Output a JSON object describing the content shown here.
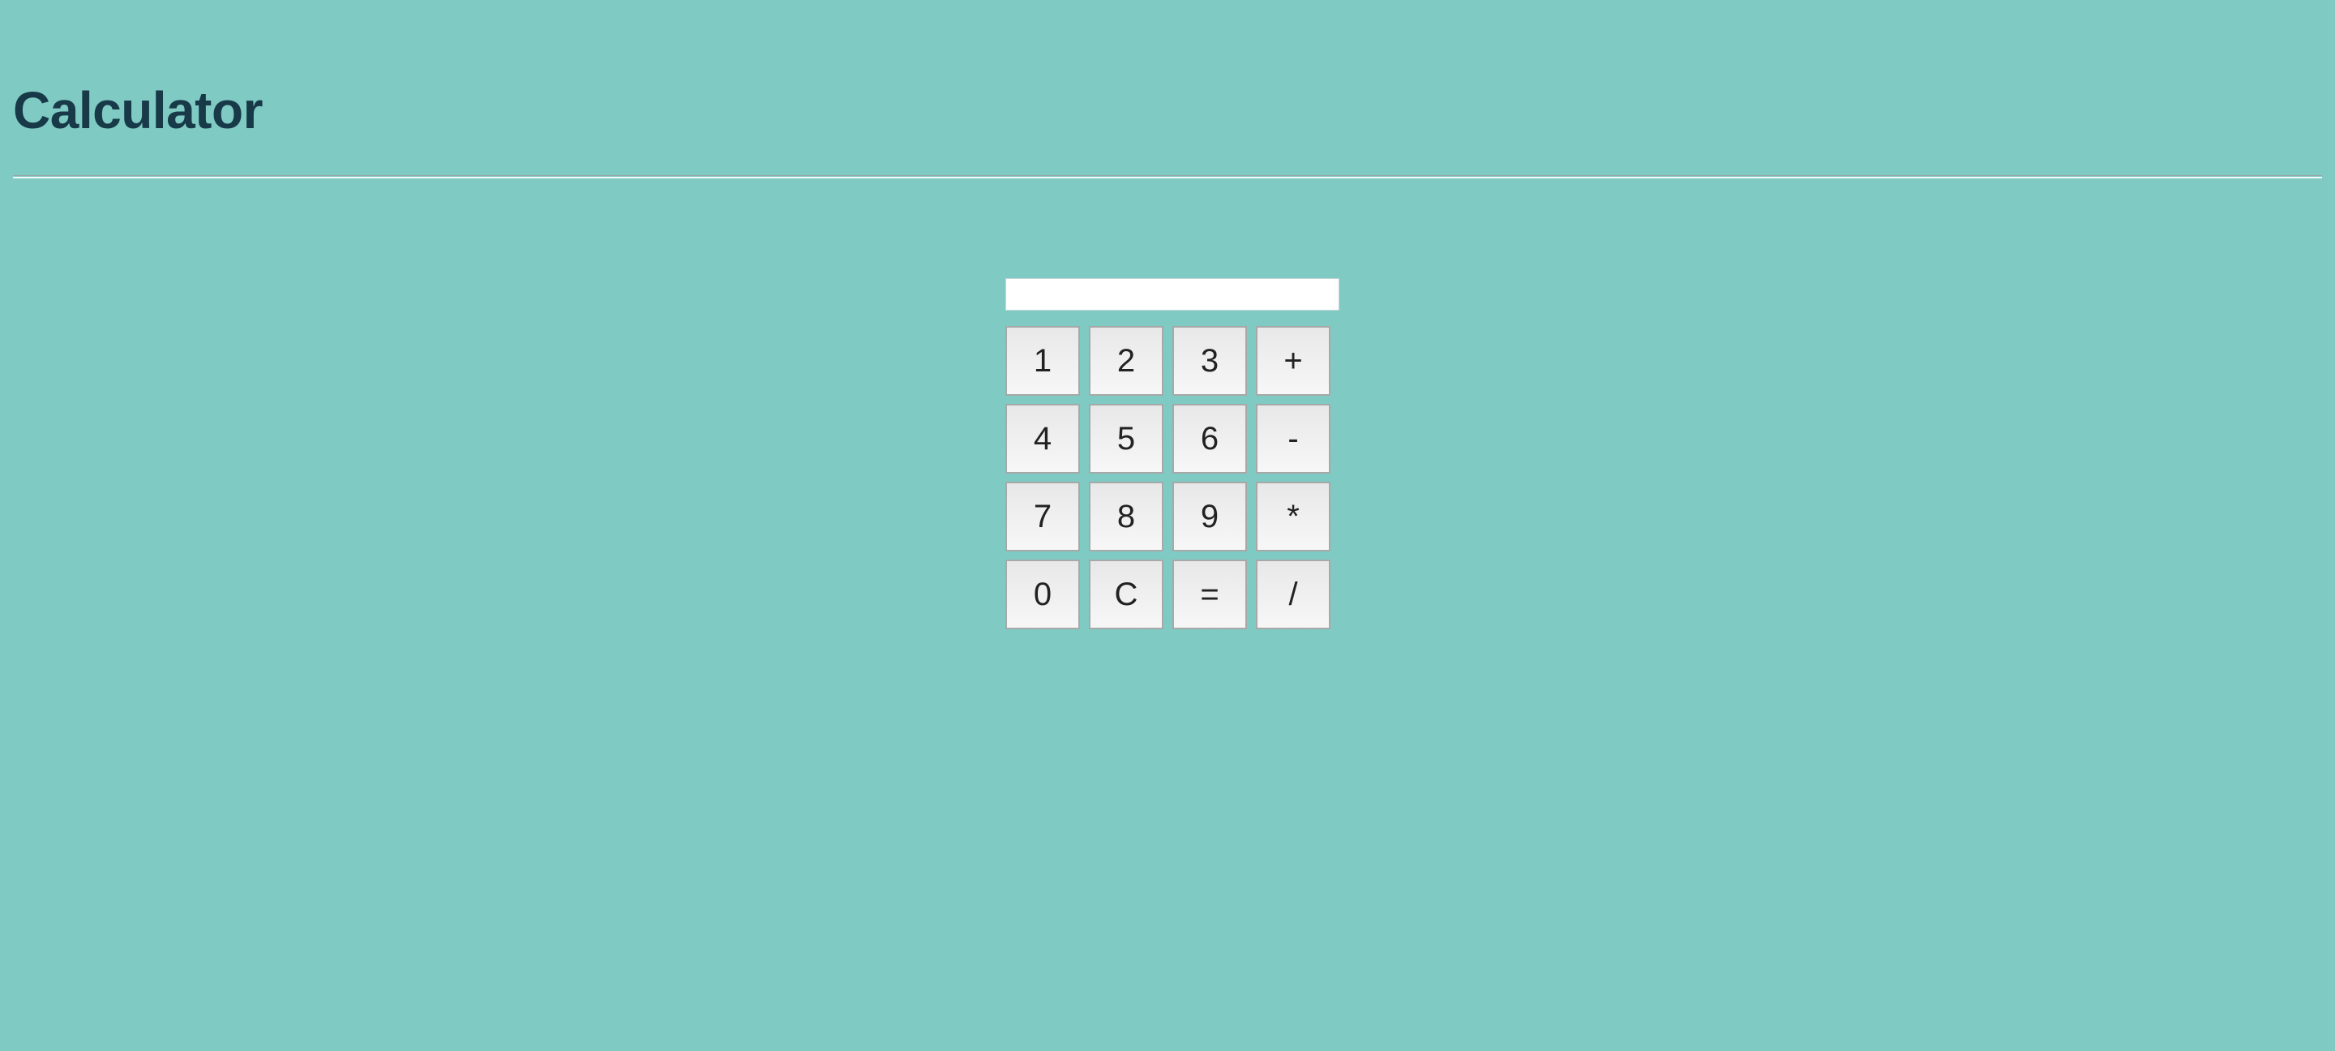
{
  "page": {
    "title": "Calculator",
    "background_color": "#80cac4",
    "title_color": "#183a48"
  },
  "display": {
    "value": "",
    "placeholder": ""
  },
  "keypad": {
    "keys": [
      {
        "label": "1",
        "name": "key-1"
      },
      {
        "label": "2",
        "name": "key-2"
      },
      {
        "label": "3",
        "name": "key-3"
      },
      {
        "label": "+",
        "name": "key-plus"
      },
      {
        "label": "4",
        "name": "key-4"
      },
      {
        "label": "5",
        "name": "key-5"
      },
      {
        "label": "6",
        "name": "key-6"
      },
      {
        "label": "-",
        "name": "key-minus"
      },
      {
        "label": "7",
        "name": "key-7"
      },
      {
        "label": "8",
        "name": "key-8"
      },
      {
        "label": "9",
        "name": "key-9"
      },
      {
        "label": "*",
        "name": "key-multiply"
      },
      {
        "label": "0",
        "name": "key-0"
      },
      {
        "label": "C",
        "name": "key-clear"
      },
      {
        "label": "=",
        "name": "key-equals"
      },
      {
        "label": "/",
        "name": "key-divide"
      }
    ]
  }
}
